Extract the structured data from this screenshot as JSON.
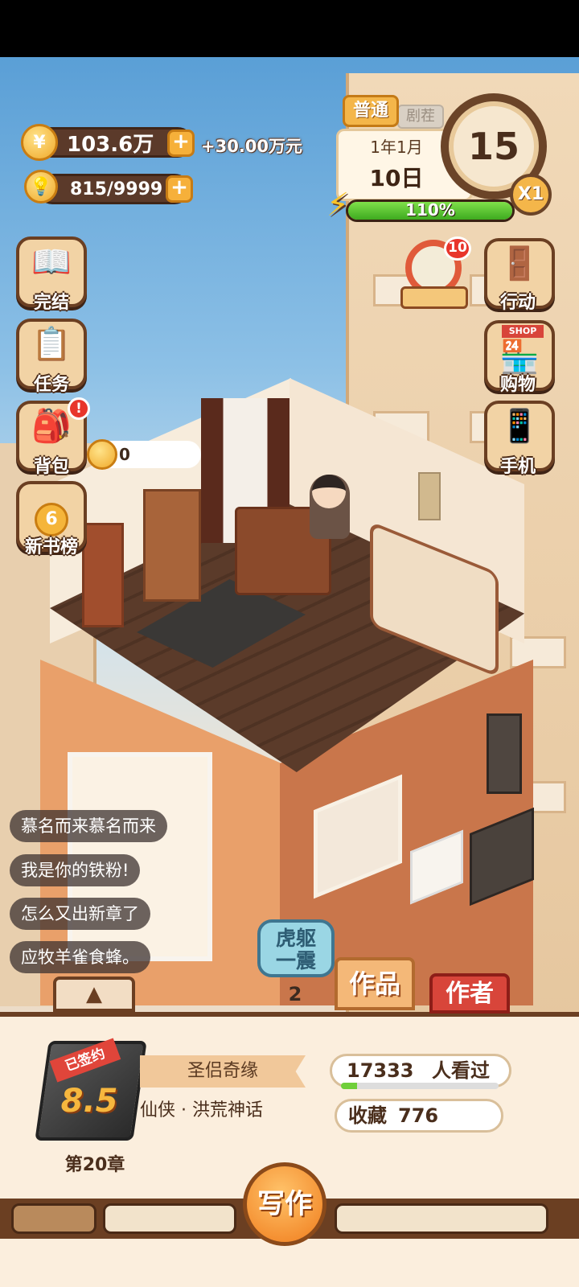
{
  "resources": {
    "money": "103.6万",
    "money_coin_icon": "yuan-coin-icon",
    "income": "+30.00万元",
    "inspiration": "815/9999",
    "inspiration_icon": "lightbulb-icon"
  },
  "calendar": {
    "mode_active": "普通",
    "mode_inactive": "剧茬",
    "year_month": "1年1月",
    "day": "10日",
    "clock_value": "15",
    "speed": "X1",
    "energy_percent_label": "110%",
    "energy_fill": 1.0
  },
  "left_menu": [
    {
      "label": "完结",
      "icon": "open-book-icon"
    },
    {
      "label": "任务",
      "icon": "checklist-icon"
    },
    {
      "label": "背包",
      "icon": "backpack-icon",
      "badge": "!"
    },
    {
      "label": "新书榜",
      "icon": "ranking-medal-icon",
      "rank": "6"
    }
  ],
  "right_menu": [
    {
      "label": "行动",
      "icon": "door-icon"
    },
    {
      "label": "购物",
      "icon": "shop-icon",
      "sign": "SHOP"
    },
    {
      "label": "手机",
      "icon": "phone-icon"
    }
  ],
  "lucky_wheel": {
    "badge": "10"
  },
  "tip_bubble": {
    "value": "0"
  },
  "comments": [
    "慕名而来慕名而来",
    "我是你的铁粉!",
    "怎么又出新章了",
    "应牧羊雀食蜂。"
  ],
  "skill": {
    "label": "虎躯一震",
    "count": "2"
  },
  "tabs": {
    "works": "作品",
    "author": "作者"
  },
  "book": {
    "status_tag": "已签约",
    "score": "8.5",
    "chapter": "第20章",
    "title": "圣侣奇缘",
    "genre": "仙侠 · 洪荒神话",
    "views": "17333",
    "views_unit": "人看过",
    "views_progress": 0.1,
    "favorites_label": "收藏",
    "favorites": "776"
  },
  "actions": {
    "write": "写作"
  }
}
